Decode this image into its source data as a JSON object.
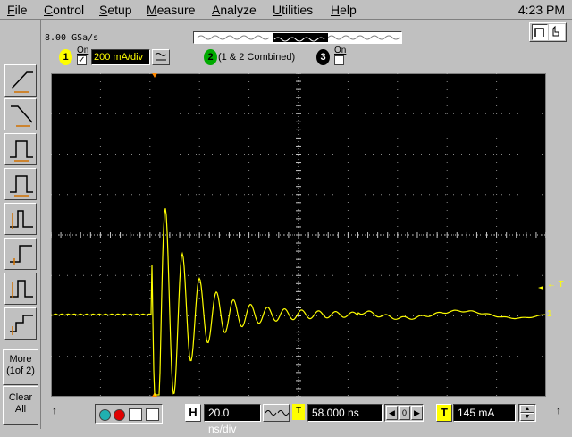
{
  "menu": {
    "items": [
      {
        "label": "File",
        "key": "F",
        "rest": "ile"
      },
      {
        "label": "Control",
        "key": "C",
        "rest": "ontrol"
      },
      {
        "label": "Setup",
        "key": "S",
        "rest": "etup"
      },
      {
        "label": "Measure",
        "key": "M",
        "rest": "easure"
      },
      {
        "label": "Analyze",
        "key": "A",
        "rest": "nalyze"
      },
      {
        "label": "Utilities",
        "key": "U",
        "rest": "tilities"
      },
      {
        "label": "Help",
        "key": "H",
        "rest": "elp"
      }
    ],
    "clock": "4:23 PM"
  },
  "status": {
    "sample_rate": "8.00 GSa/s"
  },
  "left_toolbar": {
    "buttons": [
      {
        "name": "rising-edge-trigger-icon"
      },
      {
        "name": "falling-edge-trigger-icon"
      },
      {
        "name": "pulse-width-trigger-icon"
      },
      {
        "name": "pulse-width-lt-trigger-icon"
      },
      {
        "name": "glitch-trigger-icon"
      },
      {
        "name": "runt-trigger-icon"
      },
      {
        "name": "timeout-trigger-icon"
      },
      {
        "name": "transition-trigger-icon"
      }
    ],
    "more_line1": "More",
    "more_line2": "(1of 2)",
    "clear_line1": "Clear",
    "clear_line2": "All"
  },
  "channels": {
    "ch1": {
      "number": "1",
      "on_label": "On",
      "checked": true,
      "scale": "200 mA/div",
      "color": "#ffff00"
    },
    "ch2": {
      "number": "2",
      "label": "(1 & 2 Combined)",
      "color": "#00c000"
    },
    "ch3": {
      "number": "3",
      "on_label": "On",
      "checked": false,
      "color": "#ffffff"
    }
  },
  "plot": {
    "background": "#000000",
    "trace_color": "#ffff00",
    "grid_color": "#c8c8c8",
    "trigger_label": "← T",
    "channel_marker": "1"
  },
  "bottom": {
    "time_badge": "H",
    "time_per_div": "20.0 ns/div",
    "trigger_ref": "T",
    "position": "58.000 ns",
    "pos_mid": "0",
    "trigger_badge": "T",
    "trigger_level": "145 mA"
  }
}
